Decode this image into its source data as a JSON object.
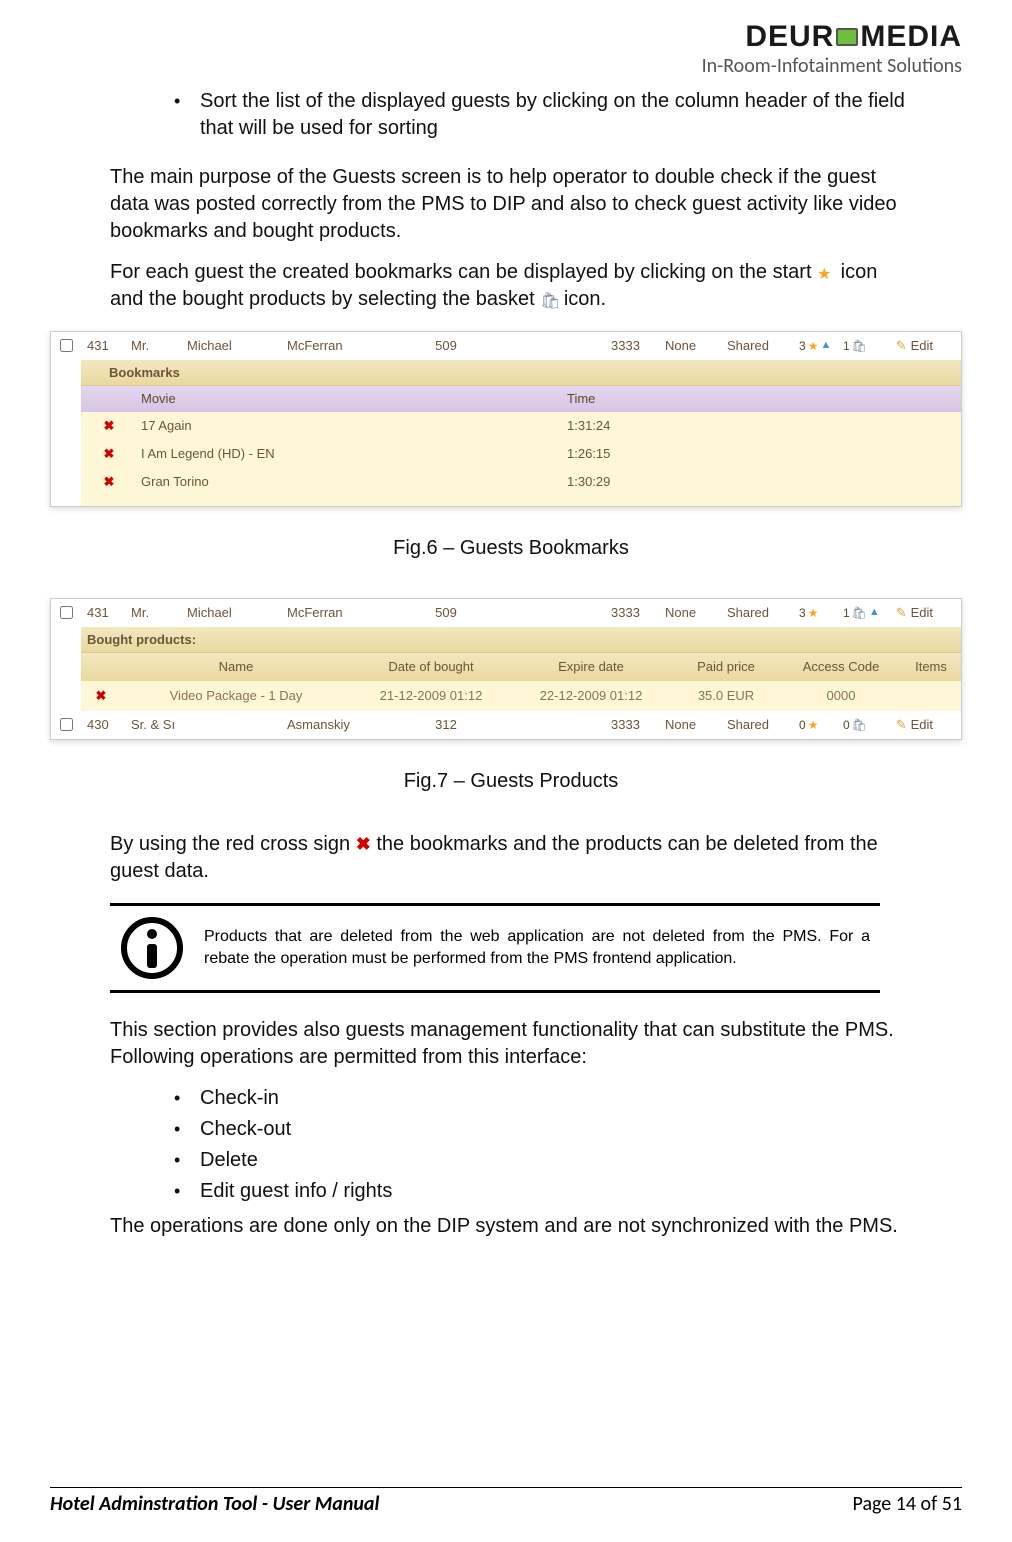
{
  "header": {
    "brand_pre": "DEUR",
    "brand_post": "MEDIA",
    "tagline": "In-Room-Infotainment Solutions"
  },
  "body": {
    "bullet1": "Sort the list of the displayed guests by clicking on the column header of the field that will be used for sorting",
    "para1": "The main purpose of the Guests screen is to help operator to double check if the guest data was posted correctly from the PMS to DIP and also to check guest activity like video bookmarks and bought products.",
    "para2a": "For each guest the created bookmarks can be displayed by clicking on the start ",
    "para2b": "icon and the bought products by selecting the basket ",
    "para2c": "icon.",
    "caption1": "Fig.6 – Guests Bookmarks",
    "caption2": "Fig.7 – Guests Products",
    "para3a": "By using the red cross sign ",
    "para3b": " the bookmarks and the products can be deleted from the guest data.",
    "note": "Products that are deleted from the web application are not deleted from the PMS. For a rebate the operation must be performed from the PMS frontend application.",
    "para4": "This section provides also guests management functionality that can substitute the PMS. Following operations are permitted from this interface:",
    "ops": [
      "Check-in",
      "Check-out",
      "Delete",
      "Edit guest info / rights"
    ],
    "para5": "The operations are done only on the DIP system and are not synchronized with the PMS."
  },
  "fig6": {
    "guest": {
      "id": "431",
      "sal": "Mr.",
      "first": "Michael",
      "last": "McFerran",
      "room": "509",
      "num": "3333",
      "none": "None",
      "shared": "Shared",
      "b1": "3",
      "b2": "1",
      "edit": "Edit"
    },
    "section": "Bookmarks",
    "headers": {
      "movie": "Movie",
      "time": "Time"
    },
    "rows": [
      {
        "movie": "17 Again",
        "time": "1:31:24"
      },
      {
        "movie": "I Am Legend (HD) - EN",
        "time": "1:26:15"
      },
      {
        "movie": "Gran Torino",
        "time": "1:30:29"
      }
    ]
  },
  "fig7": {
    "guest1": {
      "id": "431",
      "sal": "Mr.",
      "first": "Michael",
      "last": "McFerran",
      "room": "509",
      "num": "3333",
      "none": "None",
      "shared": "Shared",
      "b1": "3",
      "b2": "1",
      "edit": "Edit"
    },
    "section": "Bought products:",
    "headers": {
      "name": "Name",
      "date": "Date of bought",
      "expire": "Expire date",
      "price": "Paid price",
      "code": "Access Code",
      "items": "Items"
    },
    "product": {
      "name": "Video Package - 1 Day",
      "date": "21-12-2009 01:12",
      "expire": "22-12-2009 01:12",
      "price": "35.0 EUR",
      "code": "0000"
    },
    "guest2": {
      "id": "430",
      "sal": "Sr. & Sı",
      "first": "",
      "last": "Asmanskiy",
      "room": "312",
      "num": "3333",
      "none": "None",
      "shared": "Shared",
      "b1": "0",
      "b2": "0",
      "edit": "Edit"
    }
  },
  "footer": {
    "title": "Hotel Adminstration Tool - User Manual",
    "page": "Page 14 of 51"
  }
}
